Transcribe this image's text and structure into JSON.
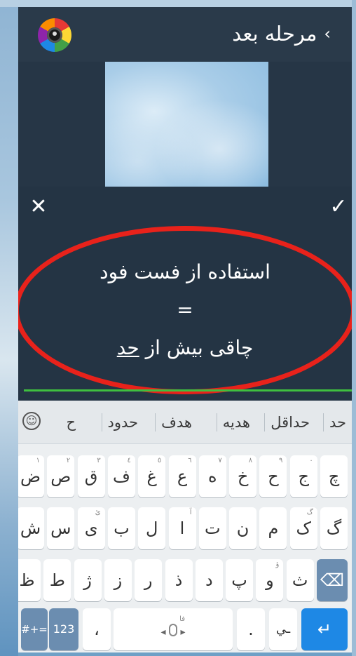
{
  "top_bar": {
    "title": "مرحله بعد",
    "back_chevron": "‹",
    "logo_icon": "camera-lens-icon"
  },
  "editor": {
    "close_symbol": "✕",
    "confirm_symbol": "✓",
    "caption_line1": "استفاده از فست فود",
    "caption_line2": "=",
    "caption_line3_start": "چاقی بیش از ",
    "caption_line3_underlined": "حد",
    "annotation_color": "#e8221b",
    "underline_color": "#3fbf3f"
  },
  "keyboard": {
    "suggestions": [
      "حد",
      "حداقل",
      "هدیه",
      "هدف",
      "حدود",
      "ح"
    ],
    "emoji_symbol": "☺",
    "row1": [
      {
        "k": "چ",
        "h": ""
      },
      {
        "k": "ج",
        "h": "٠"
      },
      {
        "k": "ح",
        "h": "٩"
      },
      {
        "k": "خ",
        "h": "٨"
      },
      {
        "k": "ه",
        "h": "٧"
      },
      {
        "k": "ع",
        "h": "٦"
      },
      {
        "k": "غ",
        "h": "٥"
      },
      {
        "k": "ف",
        "h": "٤"
      },
      {
        "k": "ق",
        "h": "٣"
      },
      {
        "k": "ص",
        "h": "٢"
      },
      {
        "k": "ض",
        "h": "١"
      }
    ],
    "row2": [
      {
        "k": "گ",
        "h": ""
      },
      {
        "k": "ک",
        "h": "گ"
      },
      {
        "k": "م",
        "h": ""
      },
      {
        "k": "ن",
        "h": ""
      },
      {
        "k": "ت",
        "h": ""
      },
      {
        "k": "ا",
        "h": "آ"
      },
      {
        "k": "ل",
        "h": ""
      },
      {
        "k": "ب",
        "h": ""
      },
      {
        "k": "ی",
        "h": "ئ"
      },
      {
        "k": "س",
        "h": ""
      },
      {
        "k": "ش",
        "h": ""
      }
    ],
    "row3": [
      {
        "k": "ث",
        "h": ""
      },
      {
        "k": "و",
        "h": "ؤ"
      },
      {
        "k": "پ",
        "h": ""
      },
      {
        "k": "د",
        "h": ""
      },
      {
        "k": "ذ",
        "h": ""
      },
      {
        "k": "ر",
        "h": ""
      },
      {
        "k": "ز",
        "h": ""
      },
      {
        "k": "ژ",
        "h": ""
      },
      {
        "k": "ط",
        "h": ""
      },
      {
        "k": "ظ",
        "h": ""
      }
    ],
    "backspace_symbol": "⌫",
    "sym_label": "#+=",
    "num_label": "123",
    "comma_label": "،",
    "dot_label": ".",
    "ye_label": "ـي",
    "enter_symbol": "↵",
    "space_hint": "فا"
  }
}
